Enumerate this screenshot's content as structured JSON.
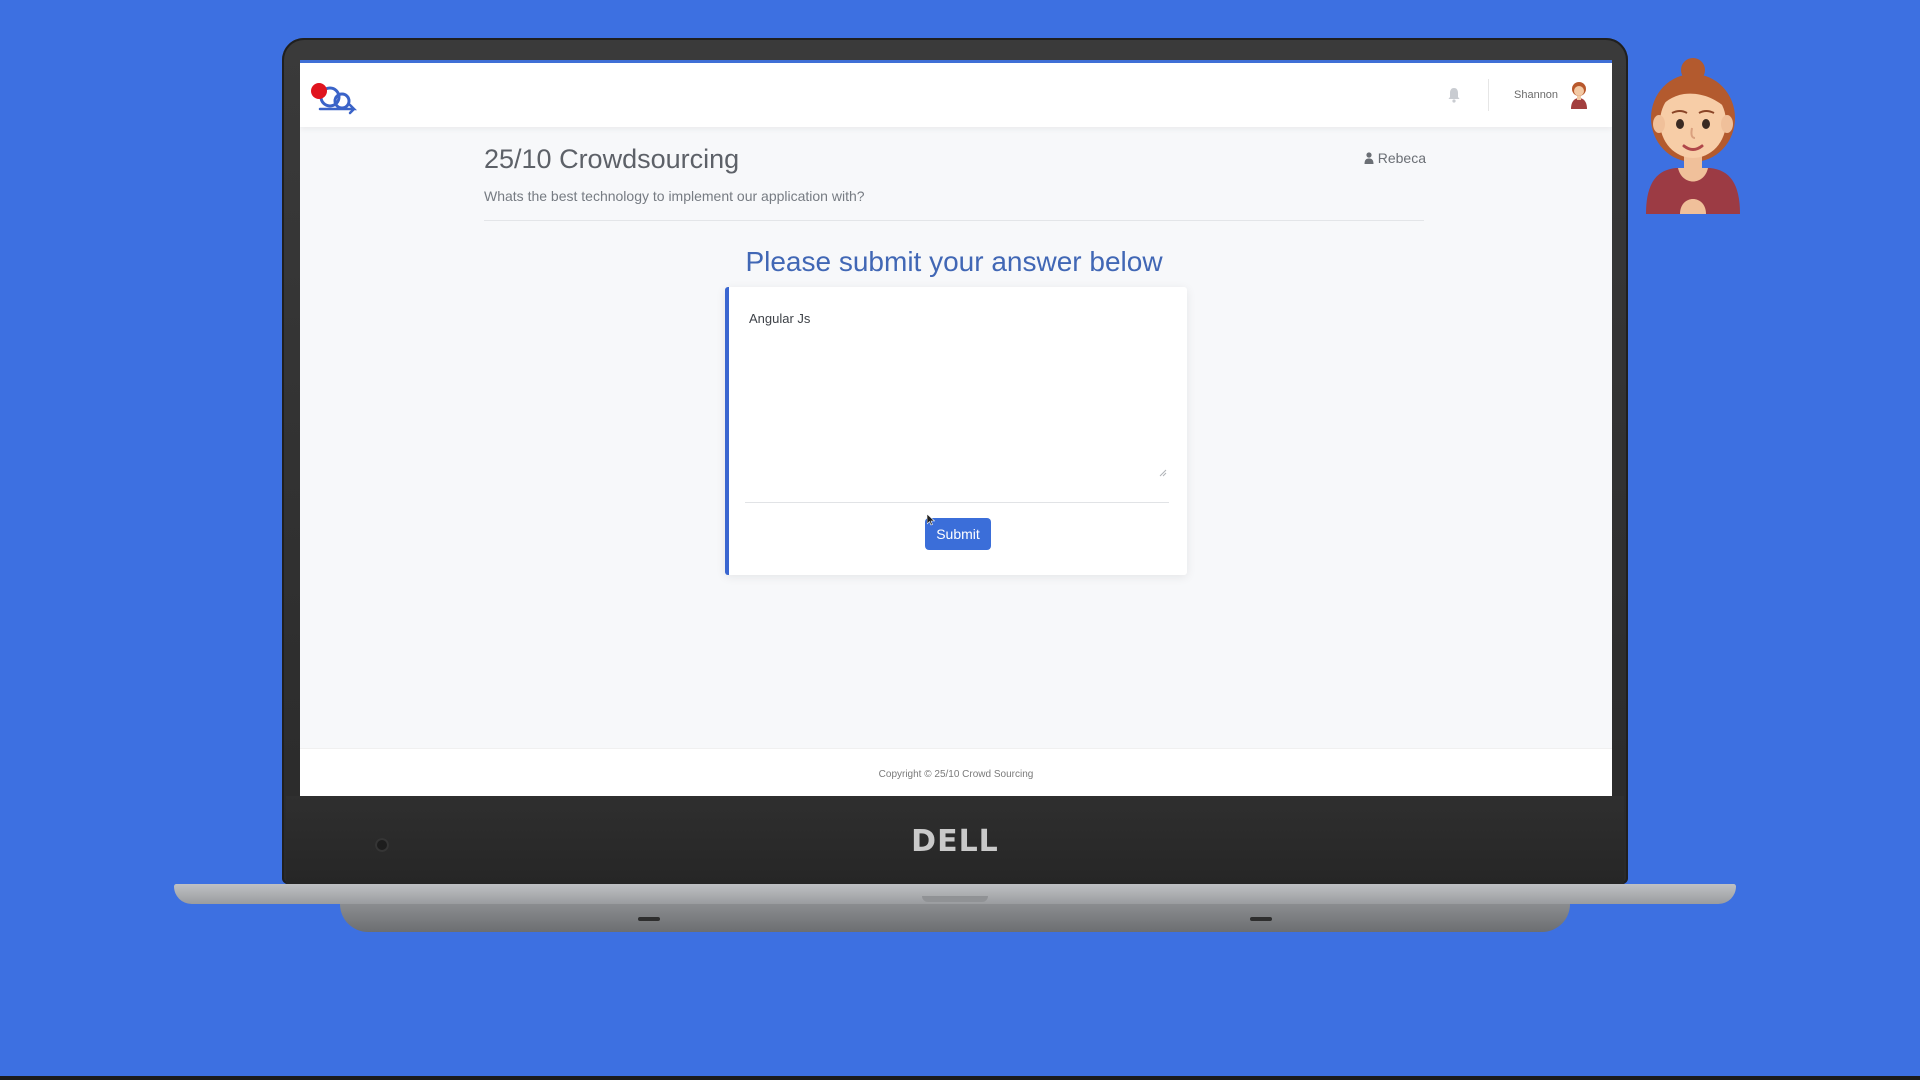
{
  "theme": {
    "background": "#3d70e1",
    "accent": "#3b6ed9",
    "heading_blue": "#4167b5"
  },
  "topbar": {
    "logo_icon": "crowd-logo-icon",
    "notification_icon": "bell-icon",
    "user_name": "Shannon",
    "avatar_icon": "user-avatar-icon"
  },
  "page": {
    "title": "25/10 Crowdsourcing",
    "subtitle": "Whats the best technology to implement our application with?",
    "author_icon": "person-icon",
    "author": "Rebeca"
  },
  "form": {
    "prompt": "Please submit your answer below",
    "answer_value": "Angular Js",
    "submit_label": "Submit"
  },
  "footer": {
    "copyright": "Copyright © 25/10 Crowd Sourcing"
  },
  "device": {
    "brand": "DELL"
  }
}
